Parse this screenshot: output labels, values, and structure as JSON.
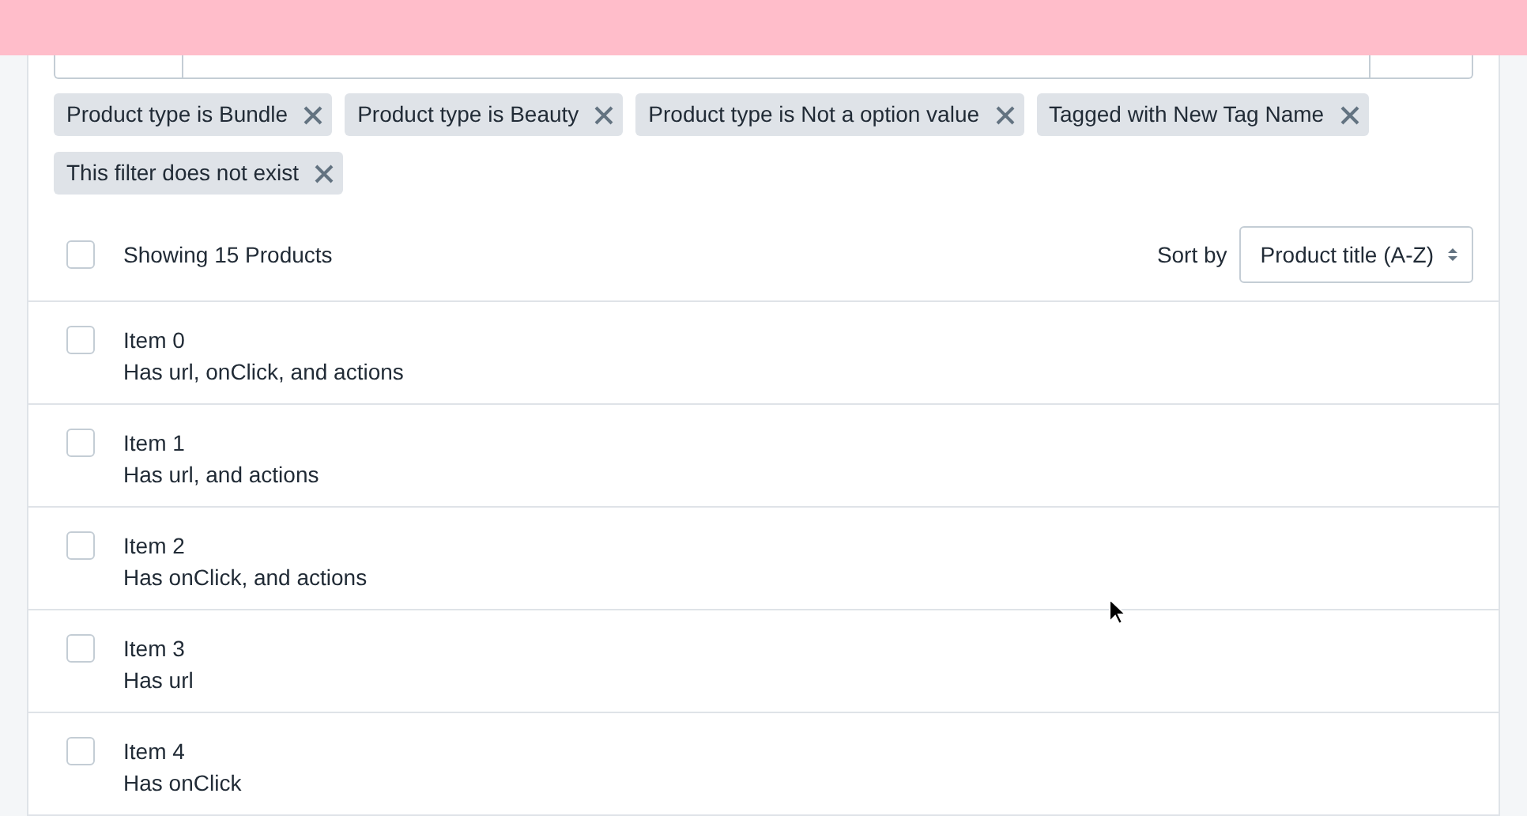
{
  "applied_filters": [
    {
      "label": "Product type is Bundle"
    },
    {
      "label": "Product type is Beauty"
    },
    {
      "label": "Product type is Not a option value"
    },
    {
      "label": "Tagged with New Tag Name"
    },
    {
      "label": "This filter does not exist"
    }
  ],
  "list_header": {
    "select_all_checked": false,
    "count": "Showing 15 Products",
    "sort_label": "Sort by",
    "sort_value": "Product title (A-Z)"
  },
  "items": [
    {
      "title": "Item 0",
      "description": "Has url, onClick, and actions",
      "checked": false
    },
    {
      "title": "Item 1",
      "description": "Has url, and actions",
      "checked": false
    },
    {
      "title": "Item 2",
      "description": "Has onClick, and actions",
      "checked": false
    },
    {
      "title": "Item 3",
      "description": "Has url",
      "checked": false
    },
    {
      "title": "Item 4",
      "description": "Has onClick",
      "checked": false
    }
  ]
}
